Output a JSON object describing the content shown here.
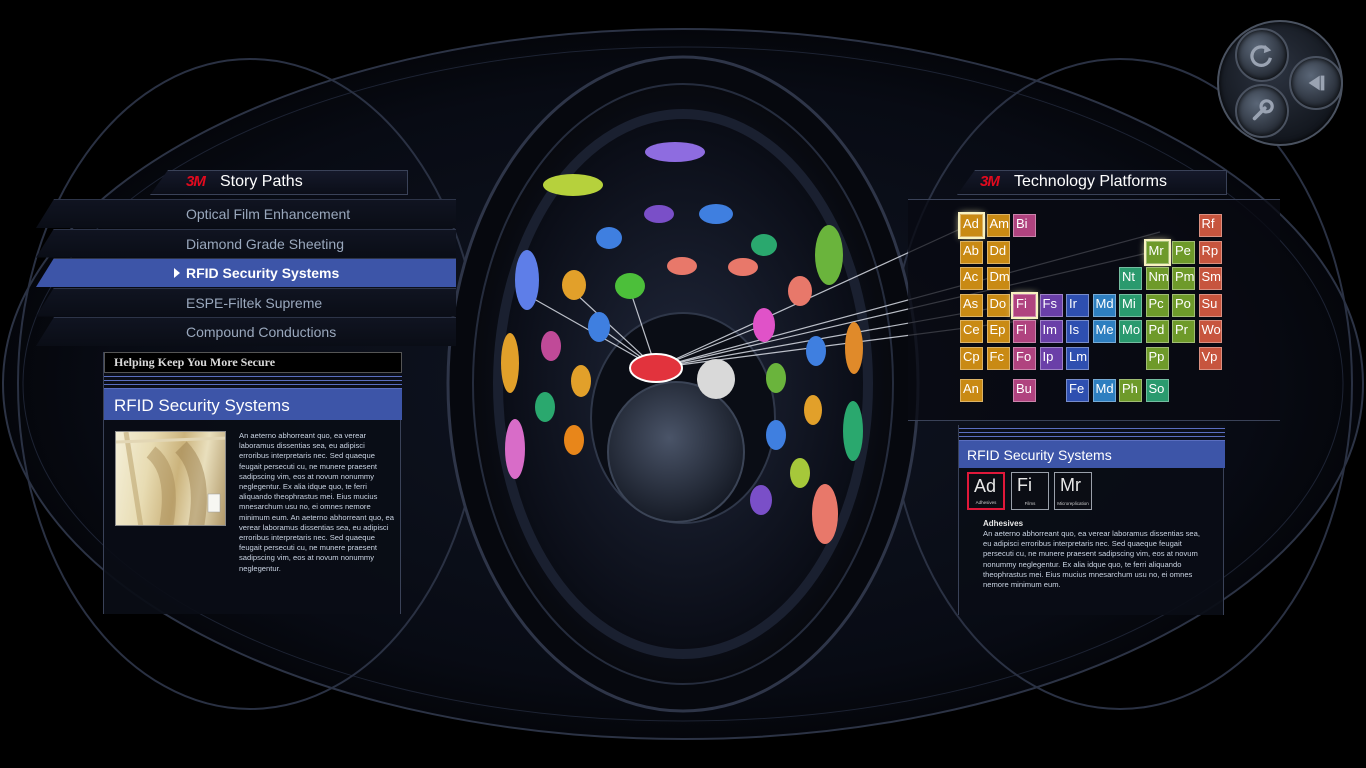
{
  "colors": {
    "accent_blue": "#3d55a8",
    "brand_red": "#e10a1e",
    "selected_red": "#e0183a"
  },
  "brand": "3M",
  "story_paths": {
    "title": "Story Paths",
    "items": [
      {
        "label": "Optical Film Enhancement",
        "active": false
      },
      {
        "label": "Diamond Grade Sheeting",
        "active": false
      },
      {
        "label": "RFID Security Systems",
        "active": true
      },
      {
        "label": "ESPE-Filtek Supreme",
        "active": false
      },
      {
        "label": "Compound Conductions",
        "active": false
      }
    ]
  },
  "story_card": {
    "banner": "Helping Keep You More Secure",
    "heading": "RFID Security Systems",
    "body": "An aeterno abhorreant quo, ea verear laboramus dissentias sea, eu adipisci erroribus interpretaris nec. Sed quaeque feugait persecuti cu, ne munere praesent sadipscing vim, eos at novum nonummy neglegentur. Ex alia idque quo, te ferri aliquando theophrastus mei. Eius mucius mnesarchum usu no, ei omnes nemore minimum eum.  An aeterno abhorreant quo, ea verear laboramus dissentias sea, eu adipisci erroribus interpretaris nec. Sed quaeque feugait persecuti cu, ne munere praesent sadipscing vim, eos at novum nonummy neglegentur."
  },
  "tech_platforms": {
    "title": "Technology Platforms",
    "elements": [
      {
        "sym": "Ad",
        "color": "#c98a14",
        "highlight": true
      },
      {
        "sym": "Am",
        "color": "#c98a14"
      },
      {
        "sym": "Bi",
        "color": "#b0437f"
      },
      {
        "sym": "Rf",
        "color": "#c7553e"
      },
      {
        "sym": "Ab",
        "color": "#c98a14"
      },
      {
        "sym": "Dd",
        "color": "#c98a14"
      },
      {
        "sym": "Mr",
        "color": "#6e9a2a",
        "highlight": true
      },
      {
        "sym": "Pe",
        "color": "#6e9a2a"
      },
      {
        "sym": "Rp",
        "color": "#c7553e"
      },
      {
        "sym": "Ac",
        "color": "#c98a14"
      },
      {
        "sym": "Dm",
        "color": "#c98a14"
      },
      {
        "sym": "Nt",
        "color": "#2a9a6e"
      },
      {
        "sym": "Nm",
        "color": "#6e9a2a"
      },
      {
        "sym": "Pm",
        "color": "#6e9a2a"
      },
      {
        "sym": "Sm",
        "color": "#c7553e"
      },
      {
        "sym": "As",
        "color": "#c98a14"
      },
      {
        "sym": "Do",
        "color": "#c98a14"
      },
      {
        "sym": "Fi",
        "color": "#b0437f",
        "highlight": true
      },
      {
        "sym": "Fs",
        "color": "#6a3fa8"
      },
      {
        "sym": "Ir",
        "color": "#2e4fb0"
      },
      {
        "sym": "Md",
        "color": "#2e7fc0"
      },
      {
        "sym": "Mi",
        "color": "#2a9a6e"
      },
      {
        "sym": "Pc",
        "color": "#6e9a2a"
      },
      {
        "sym": "Po",
        "color": "#6e9a2a"
      },
      {
        "sym": "Su",
        "color": "#c7553e"
      },
      {
        "sym": "Ce",
        "color": "#c98a14"
      },
      {
        "sym": "Ep",
        "color": "#c98a14"
      },
      {
        "sym": "Fl",
        "color": "#b0437f"
      },
      {
        "sym": "Im",
        "color": "#6a3fa8"
      },
      {
        "sym": "Is",
        "color": "#2e4fb0"
      },
      {
        "sym": "Me",
        "color": "#2e7fc0"
      },
      {
        "sym": "Mo",
        "color": "#2a9a6e"
      },
      {
        "sym": "Pd",
        "color": "#6e9a2a"
      },
      {
        "sym": "Pr",
        "color": "#6e9a2a"
      },
      {
        "sym": "Wo",
        "color": "#c7553e"
      },
      {
        "sym": "Cp",
        "color": "#c98a14"
      },
      {
        "sym": "Fc",
        "color": "#c98a14"
      },
      {
        "sym": "Fo",
        "color": "#b0437f"
      },
      {
        "sym": "Ip",
        "color": "#6a3fa8"
      },
      {
        "sym": "Lm",
        "color": "#2e4fb0"
      },
      {
        "sym": "Pp",
        "color": "#6e9a2a"
      },
      {
        "sym": "Vp",
        "color": "#c7553e"
      },
      {
        "sym": "An",
        "color": "#c98a14"
      },
      {
        "sym": "Bu",
        "color": "#b0437f"
      },
      {
        "sym": "Fe",
        "color": "#2e4fb0"
      },
      {
        "sym": "Md",
        "color": "#2e7fc0"
      },
      {
        "sym": "Ph",
        "color": "#6e9a2a"
      },
      {
        "sym": "So",
        "color": "#2a9a6e"
      }
    ]
  },
  "tech_card": {
    "heading": "RFID Security Systems",
    "tiles": [
      {
        "sym": "Ad",
        "name": "Adhesives",
        "selected": true
      },
      {
        "sym": "Fi",
        "name": "Films",
        "selected": false
      },
      {
        "sym": "Mr",
        "name": "Microreplication",
        "selected": false
      }
    ],
    "subheading": "Adhesives",
    "body": "An aeterno abhorreant quo, ea verear laboramus dissentias sea, eu adipisci erroribus interpretaris nec. Sed quaeque feugait persecuti cu, ne munere praesent sadipscing vim, eos at novum nonummy neglegentur. Ex alia idque quo, te ferri aliquando theophrastus mei. Eius mucius mnesarchum usu no, ei omnes nemore minimum eum."
  },
  "controls": {
    "refresh_icon": "refresh-icon",
    "back_icon": "back-icon",
    "settings_icon": "wrench-icon"
  }
}
